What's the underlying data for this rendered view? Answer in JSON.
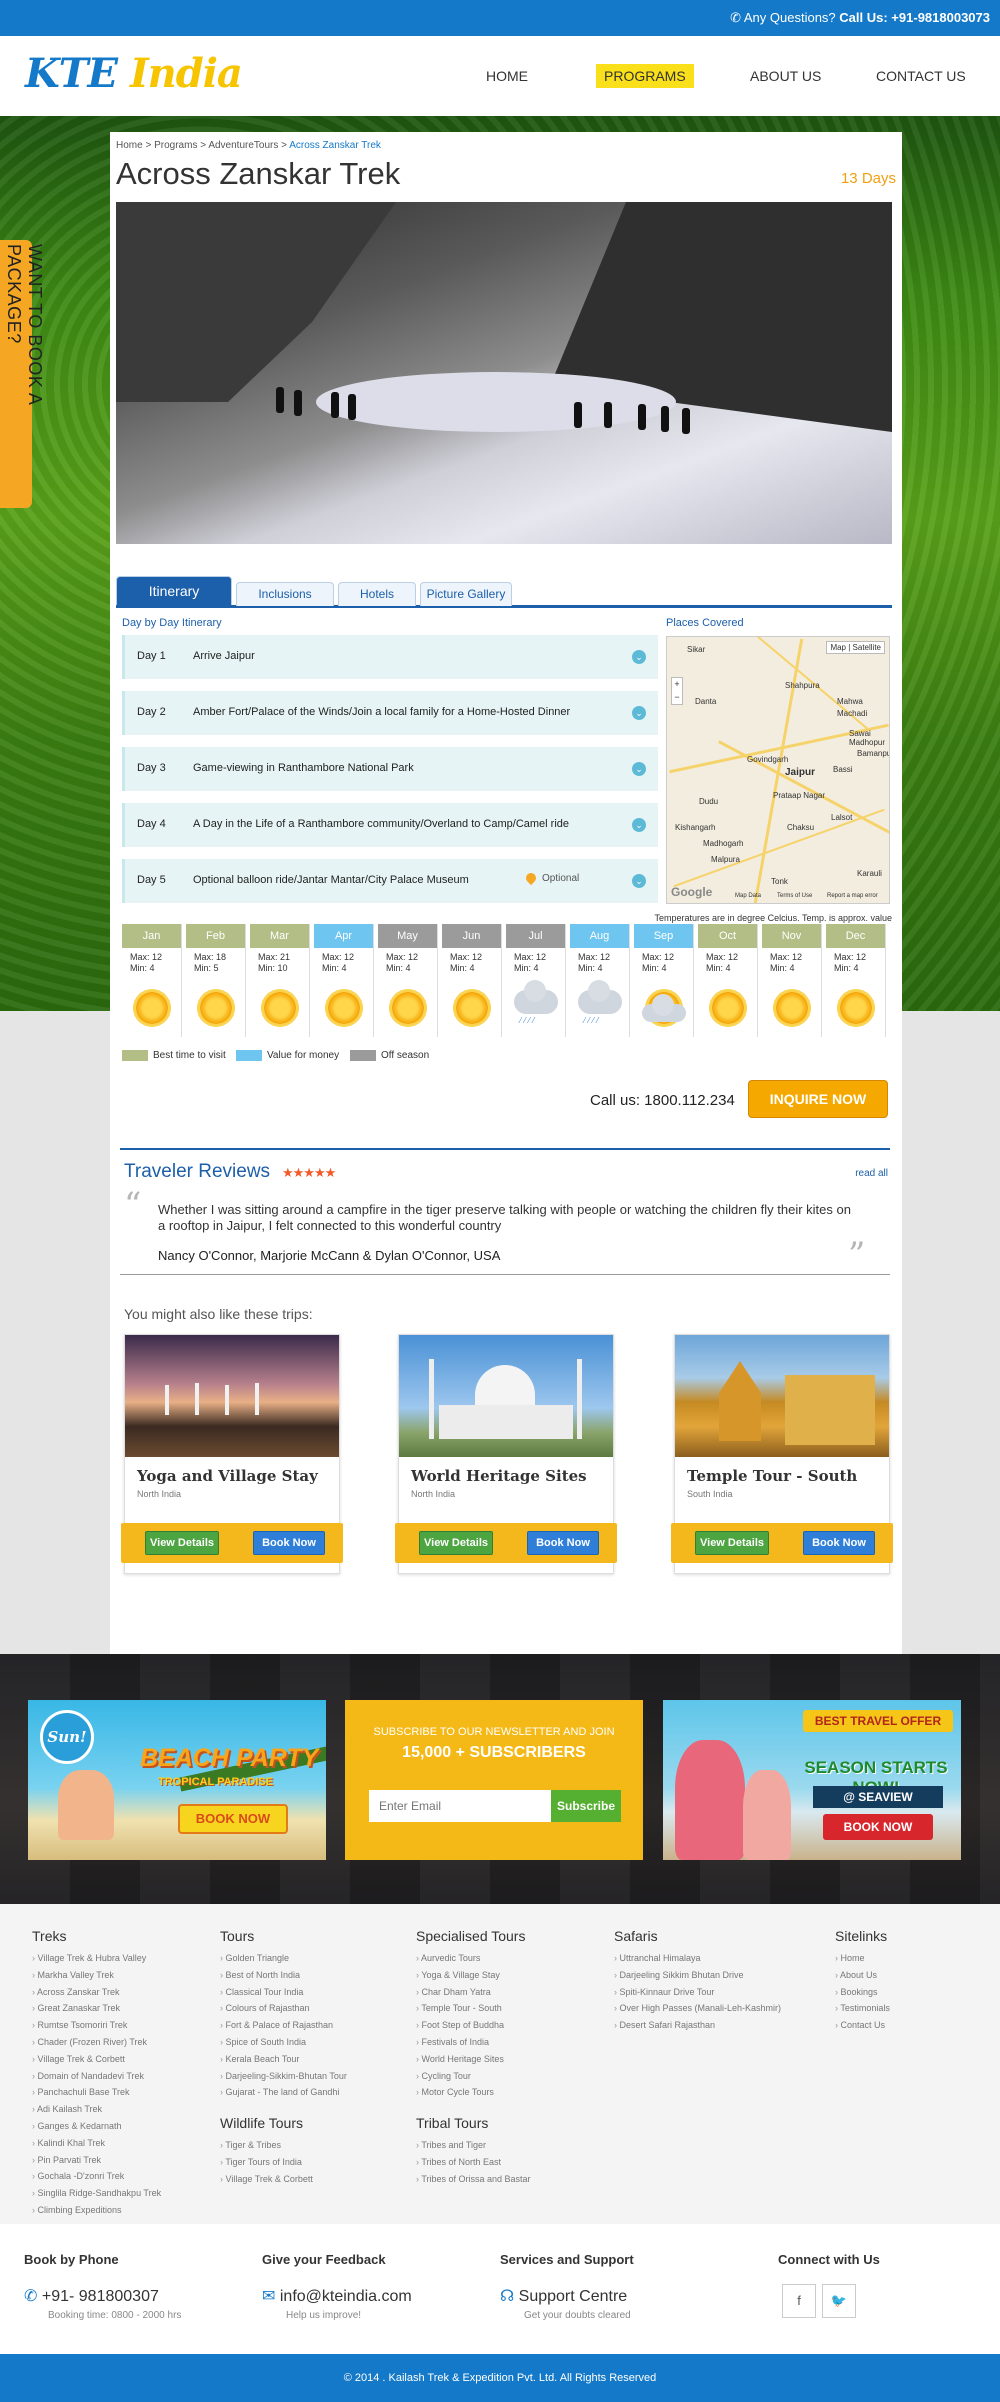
{
  "topbar": {
    "question": "Any Questions?",
    "phone": "Call Us: +91-9818003073"
  },
  "logo": {
    "part1": "KTE",
    "part2": "India"
  },
  "nav": [
    {
      "label": "HOME",
      "active": false
    },
    {
      "label": "PROGRAMS",
      "active": true
    },
    {
      "label": "ABOUT US",
      "active": false
    },
    {
      "label": "CONTACT US",
      "active": false
    }
  ],
  "side_tab": "WANT TO BOOK A PACKAGE?",
  "breadcrumb": {
    "items": [
      "Home",
      "Programs",
      "AdventureTours"
    ],
    "current": "Across Zanskar Trek",
    "sep": " > "
  },
  "tour": {
    "title": "Across Zanskar Trek",
    "duration": "13 Days"
  },
  "tabs": [
    "Itinerary",
    "Inclusions",
    "Hotels",
    "Picture Gallery"
  ],
  "itinerary": {
    "heading": "Day by Day Itinerary",
    "days": [
      {
        "day": "Day 1",
        "text": "Arrive Jaipur"
      },
      {
        "day": "Day 2",
        "text": "Amber Fort/Palace of the Winds/Join a local family for a Home-Hosted Dinner"
      },
      {
        "day": "Day 3",
        "text": "Game-viewing in Ranthambore National Park"
      },
      {
        "day": "Day 4",
        "text": "A Day in the Life of a Ranthambore community/Overland to Camp/Camel ride"
      },
      {
        "day": "Day 5",
        "text": "Optional balloon ride/Jantar Mantar/City Palace Museum",
        "optional": "Optional"
      }
    ]
  },
  "places": {
    "heading": "Places Covered",
    "map_controls": [
      "Map",
      "Satellite"
    ],
    "labels": [
      "Sikar",
      "Shahpura",
      "Danta",
      "Mahwa",
      "Machadi",
      "Sawai Madhopur",
      "Govindgarh",
      "Jaipur",
      "Bassi",
      "Bamanpura",
      "Dudu",
      "Prataap Nagar",
      "Kishangarh",
      "Chaksu",
      "Lalsot",
      "Madhogarh",
      "Malpura",
      "Tonk",
      "Karauli"
    ],
    "footer": [
      "Map Data",
      "Terms of Use",
      "Report a map error"
    ],
    "brand": "Google"
  },
  "weather": {
    "note": "Temperatures are in degree Celcius. Temp. is approx. value",
    "months": [
      {
        "m": "Jan",
        "max": "Max: 12",
        "min": "Min: 4",
        "status": "best",
        "icon": "sun-icon"
      },
      {
        "m": "Feb",
        "max": "Max: 18",
        "min": "Min: 5",
        "status": "best",
        "icon": "sun-icon"
      },
      {
        "m": "Mar",
        "max": "Max: 21",
        "min": "Min: 10",
        "status": "best",
        "icon": "sun-icon"
      },
      {
        "m": "Apr",
        "max": "Max: 12",
        "min": "Min: 4",
        "status": "value",
        "icon": "sun-icon"
      },
      {
        "m": "May",
        "max": "Max: 12",
        "min": "Min: 4",
        "status": "off",
        "icon": "sun-icon"
      },
      {
        "m": "Jun",
        "max": "Max: 12",
        "min": "Min: 4",
        "status": "off",
        "icon": "sun-icon"
      },
      {
        "m": "Jul",
        "max": "Max: 12",
        "min": "Min: 4",
        "status": "off",
        "icon": "rain-cloud-icon"
      },
      {
        "m": "Aug",
        "max": "Max: 12",
        "min": "Min: 4",
        "status": "value",
        "icon": "rain-cloud-icon"
      },
      {
        "m": "Sep",
        "max": "Max: 12",
        "min": "Min: 4",
        "status": "value",
        "icon": "sun-cloud-icon"
      },
      {
        "m": "Oct",
        "max": "Max: 12",
        "min": "Min: 4",
        "status": "best",
        "icon": "sun-icon"
      },
      {
        "m": "Nov",
        "max": "Max: 12",
        "min": "Min: 4",
        "status": "best",
        "icon": "sun-icon"
      },
      {
        "m": "Dec",
        "max": "Max: 12",
        "min": "Min: 4",
        "status": "best",
        "icon": "sun-icon"
      }
    ],
    "legend": [
      {
        "label": "Best time to visit",
        "color": "#b3bd86"
      },
      {
        "label": "Value for money",
        "color": "#6ec6f0"
      },
      {
        "label": "Off season",
        "color": "#9b9b9b"
      }
    ],
    "status_colors": {
      "best": "#b3bd86",
      "value": "#6ec6f0",
      "off": "#9b9b9b"
    }
  },
  "cta": {
    "call": "Call us: 1800.112.234",
    "button": "INQUIRE NOW"
  },
  "reviews": {
    "title": "Traveler Reviews",
    "stars": "★★★★★",
    "read_all": "read all",
    "text": "Whether I was sitting around a campfire in the tiger preserve talking with people or watching the children fly their kites on a rooftop in Jaipur, I felt connected to this wonderful country",
    "author": "Nancy O'Connor, Marjorie McCann & Dylan O'Connor, USA"
  },
  "also": {
    "title": "You might also like these trips:",
    "cards": [
      {
        "title": "Yoga and Village Stay",
        "region": "North India",
        "view": "View Details",
        "book": "Book Now"
      },
      {
        "title": "World Heritage Sites",
        "region": "North India",
        "view": "View Details",
        "book": "Book Now"
      },
      {
        "title": "Temple Tour - South",
        "region": "South India",
        "view": "View Details",
        "book": "Book Now"
      }
    ]
  },
  "promos": {
    "beach": {
      "badge": "Sun!",
      "title": "BEACH PARTY",
      "subtitle": "TROPICAL PARADISE",
      "button": "BOOK NOW"
    },
    "newsletter": {
      "line1": "SUBSCRIBE TO OUR NEWSLETTER AND JOIN",
      "line2": "15,000 + SUBSCRIBERS",
      "placeholder": "Enter Email",
      "button": "Subscribe"
    },
    "offer": {
      "banner": "BEST TRAVEL OFFER",
      "title": "SEASON STARTS NOW!",
      "sub": "@ SEAVIEW",
      "button": "BOOK NOW"
    }
  },
  "footer": {
    "treks": {
      "title": "Treks",
      "items": [
        "Village Trek & Hubra Valley",
        "Markha Valley Trek",
        "Across Zanskar Trek",
        "Great Zanaskar Trek",
        "Rumtse Tsomoriri Trek",
        "Chader (Frozen River) Trek",
        "Village Trek & Corbett",
        "Domain of Nandadevi Trek",
        "Panchachuli Base Trek",
        "Adi Kailash Trek",
        "Ganges & Kedarnath",
        "Kalindi Khal Trek",
        "Pin Parvati Trek",
        "Gochala -D'zonri Trek",
        "Singlila Ridge-Sandhakpu Trek",
        "Climbing Expeditions"
      ]
    },
    "tours": {
      "title": "Tours",
      "items": [
        "Golden Triangle",
        "Best of North India",
        "Classical Tour India",
        "Colours of Rajasthan",
        "Fort & Palace of Rajasthan",
        "Spice of South India",
        "Kerala Beach Tour",
        "Darjeeling-Sikkim-Bhutan Tour",
        "Gujarat - The land of Gandhi"
      ]
    },
    "wildlife": {
      "title": "Wildlife Tours",
      "items": [
        "Tiger & Tribes",
        "Tiger Tours of India",
        "Village Trek & Corbett"
      ]
    },
    "special": {
      "title": "Specialised Tours",
      "items": [
        "Aurvedic Tours",
        "Yoga & Village Stay",
        "Char Dham Yatra",
        "Temple Tour - South",
        "Foot Step of Buddha",
        "Festivals of India",
        "World Heritage Sites",
        "Cycling Tour",
        "Motor Cycle Tours"
      ]
    },
    "tribal": {
      "title": "Tribal Tours",
      "items": [
        "Tribes and Tiger",
        "Tribes of North East",
        "Tribes of Orissa and Bastar"
      ]
    },
    "safaris": {
      "title": "Safaris",
      "items": [
        "Uttranchal Himalaya",
        "Darjeeling Sikkim Bhutan Drive",
        "Spiti-Kinnaur Drive Tour",
        "Over High Passes (Manali-Leh-Kashmir)",
        "Desert Safari Rajasthan"
      ]
    },
    "sitelinks": {
      "title": "Sitelinks",
      "items": [
        "Home",
        "About Us",
        "Bookings",
        "Testimonials",
        "Contact Us"
      ]
    }
  },
  "contact": {
    "phone": {
      "title": "Book by Phone",
      "value": "+91- 981800307",
      "sub": "Booking time: 0800 - 2000 hrs"
    },
    "feedback": {
      "title": "Give your Feedback",
      "value": "info@kteindia.com",
      "sub": "Help us improve!"
    },
    "support": {
      "title": "Services and Support",
      "value": "Support Centre",
      "sub": "Get your doubts cleared"
    },
    "social": {
      "title": "Connect with Us",
      "fb": "f",
      "tw": "🐦"
    }
  },
  "copyright": "© 2014 . Kailash Trek & Expedition Pvt. Ltd. All Rights Reserved"
}
